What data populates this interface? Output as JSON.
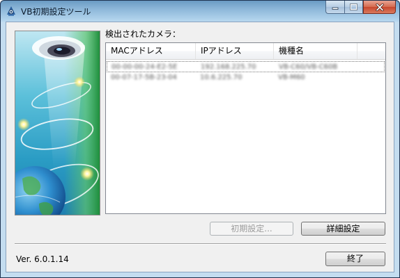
{
  "window": {
    "title": "VB初期設定ツール",
    "icon": "camera-app-icon"
  },
  "caption_buttons": [
    "minimize-icon",
    "maximize-icon",
    "close-icon"
  ],
  "list_label": "検出されたカメラ：",
  "table": {
    "columns": [
      "MACアドレス",
      "IPアドレス",
      "機種名"
    ],
    "rows": [
      [
        "00-00-00-24-E2-5E",
        "192.168.225.70",
        "VB-C60/VB-C60B"
      ],
      [
        "00-07-17-5B-23-04",
        "10.6.225.70",
        "VB-M60"
      ]
    ]
  },
  "buttons": {
    "initial_setup": "初期設定...",
    "advanced_settings": "詳細設定",
    "exit": "終了"
  },
  "version": "Ver. 6.0.1.14",
  "colors": {
    "title_gradient_top": "#6a9bc3",
    "close_button": "#c8472d",
    "banner_sky": "#3aa3c9",
    "banner_green": "#2aa455"
  }
}
